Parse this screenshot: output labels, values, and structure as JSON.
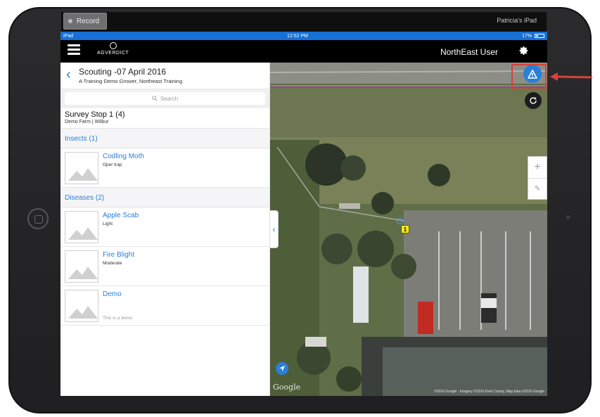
{
  "recording": {
    "button_label": "Record",
    "device_name": "Patricia's iPad"
  },
  "statusbar": {
    "carrier": "iPad",
    "time": "12:52 PM",
    "battery": "17%"
  },
  "navbar": {
    "brand": "AGVERDICT",
    "user": "NorthEast User"
  },
  "header": {
    "title": "Scouting -07 April 2016",
    "subtitle": "A Training Demo Grower, Northeast Training"
  },
  "search": {
    "placeholder": "Search"
  },
  "stop": {
    "title": "Survey Stop 1 (4)",
    "location": "Demo Farm | Wilbur"
  },
  "sections": [
    {
      "label": "Insects (1)",
      "items": [
        {
          "name": "Codling Moth",
          "severity": "Oper trap",
          "note": ""
        }
      ]
    },
    {
      "label": "Diseases (2)",
      "items": [
        {
          "name": "Apple Scab",
          "severity": "Light",
          "note": ""
        },
        {
          "name": "Fire Blight",
          "severity": "Moderate",
          "note": ""
        },
        {
          "name": "Demo",
          "severity": "",
          "note": "This is a demo"
        }
      ]
    }
  ],
  "map": {
    "marker_number": "1",
    "google_label": "Google",
    "attribution": "©2016 Google · Imagery ©2016 Kent County, Map data ©2016 Google"
  },
  "colors": {
    "accent": "#2a7fd8",
    "statusbar": "#1670d6",
    "highlight": "#d9413a",
    "marker": "#f7e818"
  }
}
